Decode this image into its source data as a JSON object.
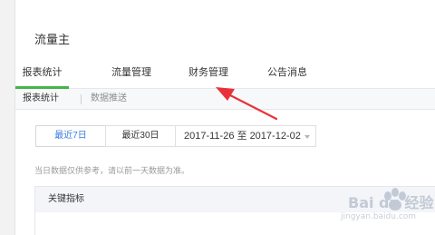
{
  "page_title": "流量主",
  "tabs": [
    {
      "label": "报表统计",
      "active": true
    },
    {
      "label": "流量管理",
      "active": false
    },
    {
      "label": "财务管理",
      "active": false
    },
    {
      "label": "公告消息",
      "active": false
    }
  ],
  "subnav": {
    "items": [
      "报表统计",
      "数据推送"
    ]
  },
  "filters": {
    "ranges": [
      {
        "label": "最近7日",
        "active": true
      },
      {
        "label": "最近30日",
        "active": false
      }
    ],
    "date_range": "2017-11-26 至 2017-12-02"
  },
  "note": "当日数据仅供参考，请以前一天数据为准。",
  "table": {
    "header": "关键指标"
  },
  "watermark": {
    "brand": "Bai du 经验",
    "url": "jingyan.baidu.com"
  },
  "colors": {
    "accent_green": "#44b549",
    "link_blue": "#3a7ee0",
    "annotation_red": "#e8323a"
  }
}
